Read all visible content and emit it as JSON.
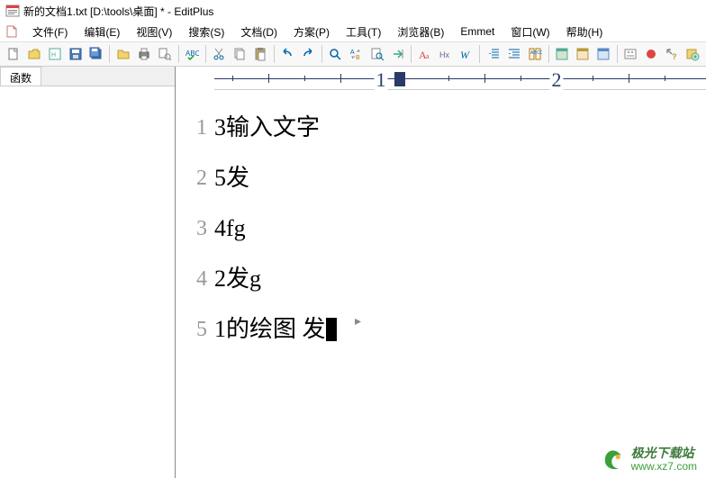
{
  "title": "新的文档1.txt [D:\\tools\\桌面] * - EditPlus",
  "menu": {
    "file": "文件(F)",
    "edit": "编辑(E)",
    "view": "视图(V)",
    "search": "搜索(S)",
    "document": "文档(D)",
    "project": "方案(P)",
    "tools": "工具(T)",
    "browser": "浏览器(B)",
    "emmet": "Emmet",
    "window": "窗口(W)",
    "help": "帮助(H)"
  },
  "side_panel": {
    "tab_label": "函数"
  },
  "ruler": {
    "marks": [
      "1",
      "2"
    ]
  },
  "editor": {
    "line_numbers": [
      "1",
      "2",
      "3",
      "4",
      "5"
    ],
    "lines": [
      "3输入文字",
      "5发",
      "4fg",
      "2发g",
      "1的绘图 发"
    ]
  },
  "watermark": {
    "name": "极光下载站",
    "url": "www.xz7.com"
  }
}
